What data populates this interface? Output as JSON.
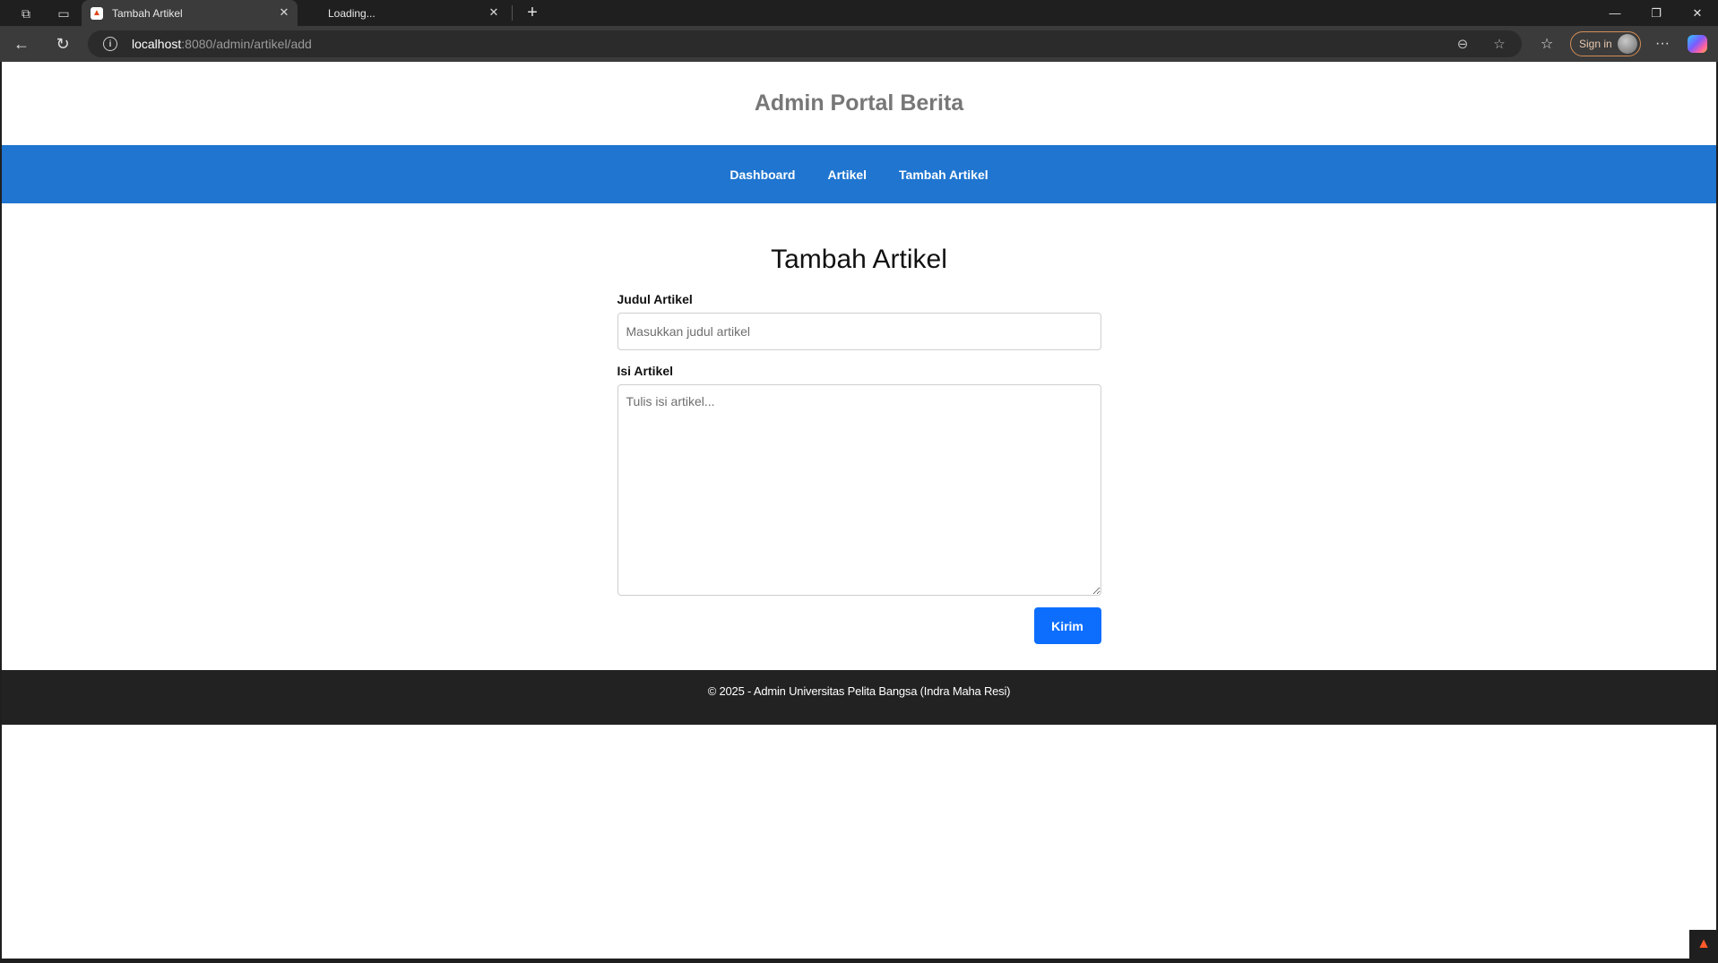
{
  "browser": {
    "tabs": [
      {
        "title": "Tambah Artikel",
        "active": true,
        "favicon": "flame-icon"
      },
      {
        "title": "Loading...",
        "active": false
      }
    ],
    "url_host": "localhost",
    "url_path": ":8080/admin/artikel/add",
    "sign_in_label": "Sign in",
    "more_label": "···"
  },
  "site": {
    "header_title": "Admin Portal Berita",
    "nav": [
      {
        "label": "Dashboard"
      },
      {
        "label": "Artikel"
      },
      {
        "label": "Tambah Artikel"
      }
    ],
    "page_title": "Tambah Artikel",
    "form": {
      "title_label": "Judul Artikel",
      "title_placeholder": "Masukkan judul artikel",
      "title_value": "",
      "content_label": "Isi Artikel",
      "content_placeholder": "Tulis isi artikel...",
      "content_value": "",
      "submit_label": "Kirim"
    },
    "footer_text": "© 2025 - Admin Universitas Pelita Bangsa (Indra Maha Resi)"
  },
  "colors": {
    "nav_bg": "#1f75cf",
    "button_bg": "#0d6efd",
    "footer_bg": "#222222",
    "header_title": "#777777"
  }
}
